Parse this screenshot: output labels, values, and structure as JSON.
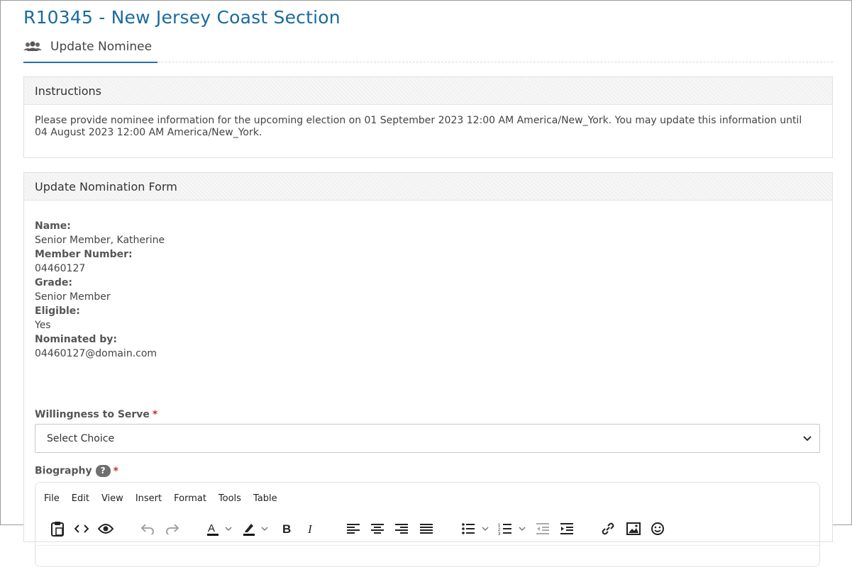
{
  "page": {
    "title": "R10345 - New Jersey Coast Section",
    "tab_label": "Update Nominee",
    "tab_icon": "users-icon"
  },
  "instructions": {
    "header": "Instructions",
    "body_line1": "Please provide nominee information for the upcoming election on 01 September 2023 12:00 AM America/New_York. You may update this information until",
    "body_line2": "04 August 2023 12:00 AM America/New_York."
  },
  "form": {
    "header": "Update Nomination Form",
    "details": [
      {
        "label": "Name:",
        "value": "Senior Member, Katherine"
      },
      {
        "label": "Member Number:",
        "value": "04460127"
      },
      {
        "label": "Grade:",
        "value": "Senior Member"
      },
      {
        "label": "Eligible:",
        "value": "Yes"
      },
      {
        "label": "Nominated by:",
        "value": "04460127@domain.com"
      }
    ],
    "willingness_label": "Willingness to Serve",
    "required_mark": "*",
    "willingness_value": "Select Choice",
    "biography_label": "Biography",
    "help_glyph": "?",
    "editor_menu": [
      "File",
      "Edit",
      "View",
      "Insert",
      "Format",
      "Tools",
      "Table"
    ],
    "editor_tools": [
      "paste-icon",
      "source-code-icon",
      "preview-icon",
      "undo-icon",
      "redo-icon",
      "text-color-icon",
      "highlight-icon",
      "bold-icon",
      "italic-icon",
      "align-left-icon",
      "align-center-icon",
      "align-right-icon",
      "justify-icon",
      "bullet-list-icon",
      "numbered-list-icon",
      "outdent-icon",
      "indent-icon",
      "link-icon",
      "image-icon",
      "emoji-icon"
    ]
  },
  "colors": {
    "title": "#1a6aa0",
    "tab_underline": "#2a6fa8",
    "required": "#c9302c"
  }
}
